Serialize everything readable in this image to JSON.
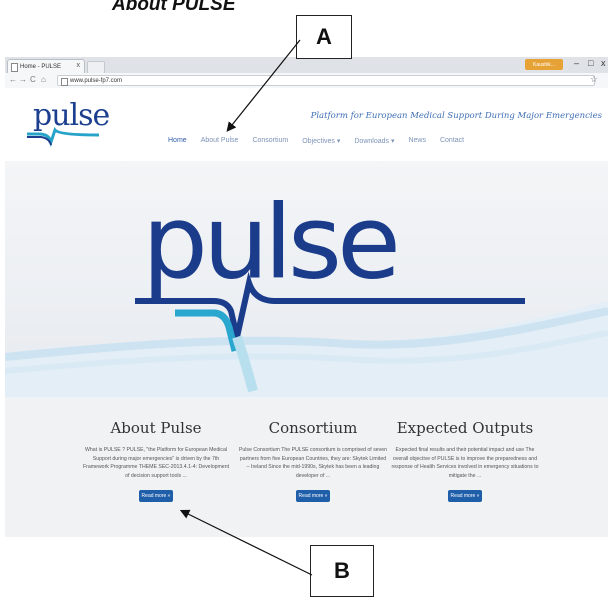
{
  "figure": {
    "title": "About PULSE",
    "label_a": "A",
    "label_b": "B"
  },
  "browser": {
    "tab_title": "Home - PULSE",
    "tab_close": "x",
    "user_chip": "Kaushik...",
    "window_controls": [
      "–",
      "□",
      "x"
    ],
    "url": "www.pulse-fp7.com"
  },
  "site": {
    "logo": "pulse",
    "tagline": "Platform for European Medical Support During Major Emergencies",
    "nav": [
      "Home",
      "About Pulse",
      "Consortium",
      "Objectives ▾",
      "Downloads ▾",
      "News",
      "Contact"
    ],
    "hero_logo": "pulse"
  },
  "columns": [
    {
      "heading": "About Pulse",
      "text": "What is PULSE ? PULSE, \"the Platform for European Medical Support during major emergencies\" is driven by the 7th Framework Programme THEME SEC-2013.4.1-4: Development of decision support tools ...",
      "button": "Read more »"
    },
    {
      "heading": "Consortium",
      "text": "Pulse Consortium The PULSE consortium is comprised of seven partners from five European Countries, they are: Skytek Limited – Ireland Since the mid-1990s, Skytek has been a leading developer of ...",
      "button": "Read more »"
    },
    {
      "heading": "Expected Outputs",
      "text": "Expected final results and their potential impact and use The overall objective of PULSE is to improve the preparedness and response of Health Services involved in emergency situations to mitigate the ...",
      "button": "Read more »"
    }
  ],
  "colors": {
    "brand_blue": "#1d3f8f",
    "button_blue": "#1f5ea8",
    "tagline_blue": "#3f6fb5",
    "user_chip": "#e7a235"
  }
}
